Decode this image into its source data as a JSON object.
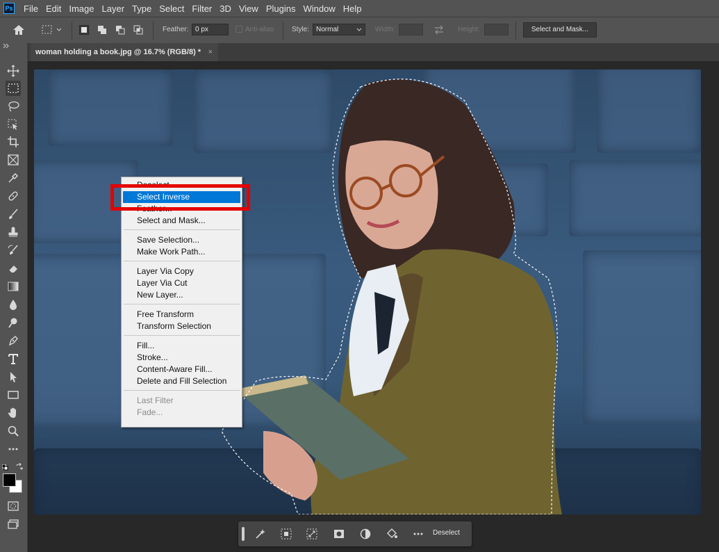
{
  "app": {
    "logo": "Ps"
  },
  "menubar": {
    "items": [
      "File",
      "Edit",
      "Image",
      "Layer",
      "Type",
      "Select",
      "Filter",
      "3D",
      "View",
      "Plugins",
      "Window",
      "Help"
    ]
  },
  "options": {
    "feather_label": "Feather:",
    "feather_value": "0 px",
    "antialias_label": "Anti-alias",
    "style_label": "Style:",
    "style_value": "Normal",
    "width_label": "Width:",
    "height_label": "Height:",
    "select_mask_button": "Select and Mask..."
  },
  "document": {
    "tab_title": "woman holding a book.jpg @ 16.7% (RGB/8) *",
    "close_glyph": "×"
  },
  "context_menu": {
    "items": [
      {
        "label": "Deselect"
      },
      {
        "label": "Select Inverse",
        "highlighted": true
      },
      {
        "label": "Feather..."
      },
      {
        "label": "Select and Mask..."
      },
      {
        "label": "Save Selection..."
      },
      {
        "label": "Make Work Path..."
      },
      {
        "label": "Layer Via Copy"
      },
      {
        "label": "Layer Via Cut"
      },
      {
        "label": "New Layer..."
      },
      {
        "label": "Free Transform"
      },
      {
        "label": "Transform Selection"
      },
      {
        "label": "Fill..."
      },
      {
        "label": "Stroke..."
      },
      {
        "label": "Content-Aware Fill..."
      },
      {
        "label": "Delete and Fill Selection"
      },
      {
        "label": "Last Filter",
        "disabled": true
      },
      {
        "label": "Fade...",
        "disabled": true
      }
    ]
  },
  "taskbar": {
    "deselect_label": "Deselect"
  },
  "colors": {
    "highlight": "#0078d7",
    "annotation": "#e50000",
    "foreground": "#000000",
    "background": "#ffffff"
  },
  "tools": [
    "move-tool",
    "rectangular-marquee-tool",
    "lasso-tool",
    "object-selection-tool",
    "crop-tool",
    "frame-tool",
    "eyedropper-tool",
    "healing-brush-tool",
    "brush-tool",
    "clone-stamp-tool",
    "history-brush-tool",
    "eraser-tool",
    "gradient-tool",
    "blur-tool",
    "dodge-tool",
    "pen-tool",
    "type-tool",
    "path-selection-tool",
    "rectangle-tool",
    "hand-tool",
    "zoom-tool",
    "more-tools"
  ]
}
